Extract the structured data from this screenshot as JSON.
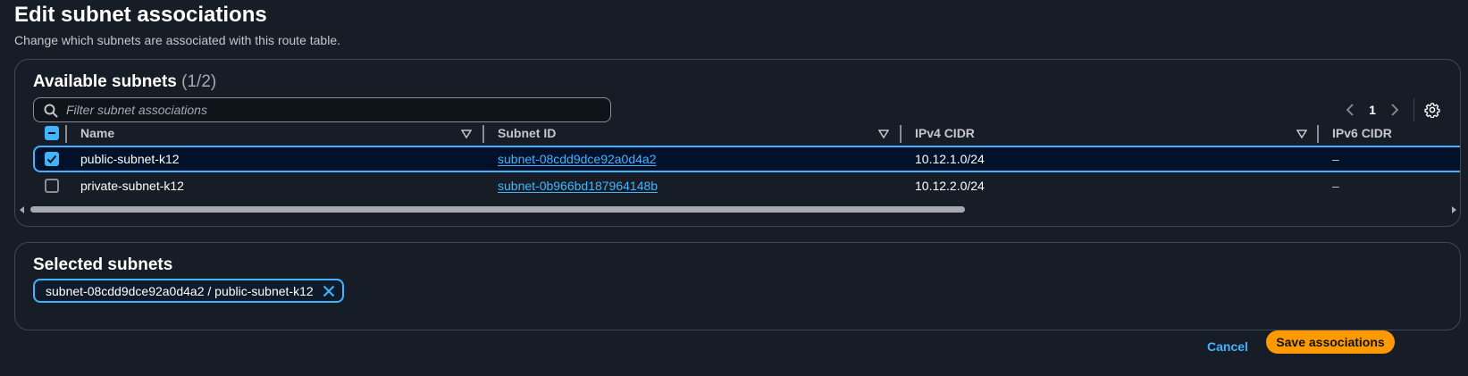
{
  "header": {
    "title": "Edit subnet associations",
    "description": "Change which subnets are associated with this route table."
  },
  "available": {
    "title": "Available subnets",
    "count": "(1/2)",
    "filter_placeholder": "Filter subnet associations",
    "page": "1",
    "columns": [
      "Name",
      "Subnet ID",
      "IPv4 CIDR",
      "IPv6 CIDR"
    ],
    "rows": [
      {
        "name": "public-subnet-k12",
        "subnet_id": "subnet-08cdd9dce92a0d4a2",
        "ipv4": "10.12.1.0/24",
        "ipv6": "–",
        "checked": true
      },
      {
        "name": "private-subnet-k12",
        "subnet_id": "subnet-0b966bd187964148b",
        "ipv4": "10.12.2.0/24",
        "ipv6": "–",
        "checked": false
      }
    ]
  },
  "selected": {
    "title": "Selected subnets",
    "token": "subnet-08cdd9dce92a0d4a2 / public-subnet-k12"
  },
  "actions": {
    "cancel": "Cancel",
    "save": "Save associations"
  },
  "colors": {
    "accent": "#42b4ff",
    "primary_button": "#ff9900",
    "background": "#161d26"
  }
}
